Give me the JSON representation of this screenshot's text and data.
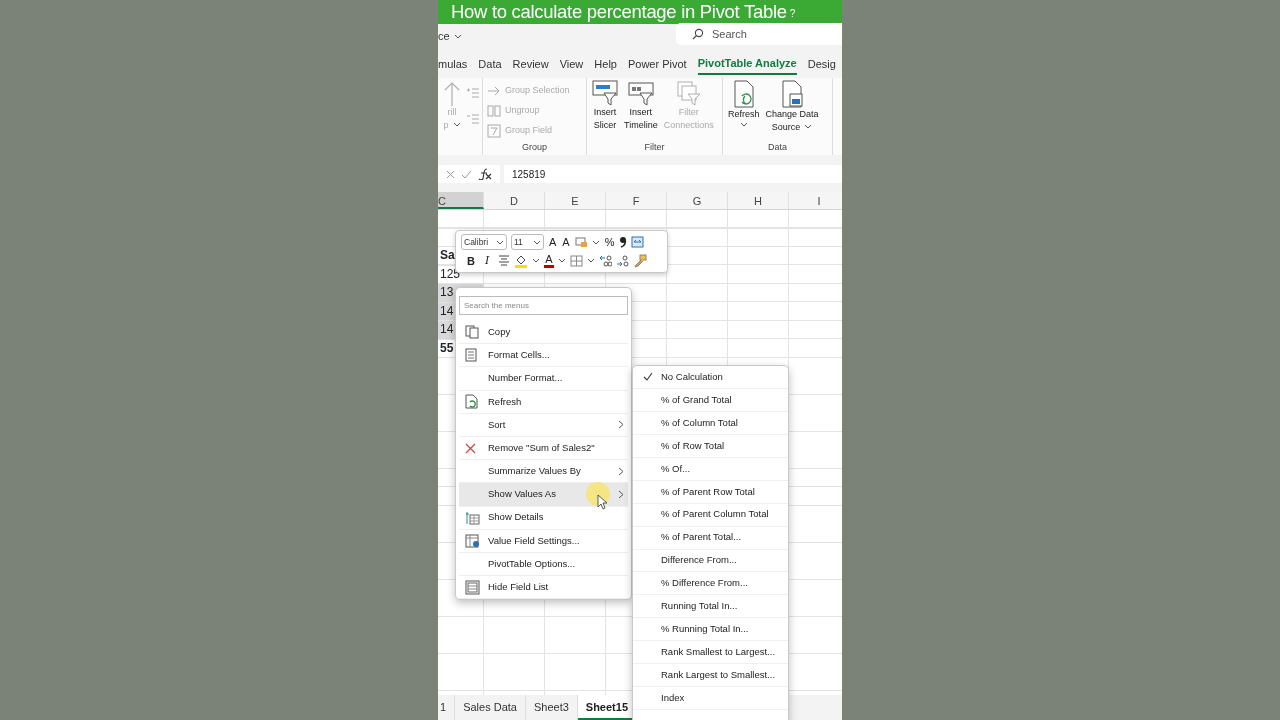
{
  "banner": {
    "title": "How to calculate percentage in Pivot Table",
    "suffix": "?"
  },
  "title_bar": {
    "account": "ce",
    "search": {
      "placeholder": "Search"
    }
  },
  "ribbon_tabs": [
    {
      "label": "mulas",
      "selected": false
    },
    {
      "label": "Data",
      "selected": false
    },
    {
      "label": "Review",
      "selected": false
    },
    {
      "label": "View",
      "selected": false
    },
    {
      "label": "Help",
      "selected": false
    },
    {
      "label": "Power Pivot",
      "selected": false
    },
    {
      "label": "PivotTable Analyze",
      "selected": true
    },
    {
      "label": "Desig",
      "selected": false
    }
  ],
  "ribbon_groups": [
    {
      "items": [
        {
          "kind": "large",
          "lines": [
            "rill",
            "p"
          ],
          "dropdown": true,
          "disabled": true
        },
        {
          "kind": "icons",
          "disabled": true
        }
      ]
    },
    {
      "name": "Group",
      "items": [
        {
          "kind": "small",
          "label": "Group Selection",
          "disabled": true
        },
        {
          "kind": "small",
          "label": "Ungroup",
          "disabled": true
        },
        {
          "kind": "small",
          "label": "Group Field",
          "disabled": true
        }
      ]
    },
    {
      "name": "Filter",
      "items": [
        {
          "kind": "large",
          "lines": [
            "Insert",
            "Slicer"
          ],
          "dropdown": false,
          "disabled": false
        },
        {
          "kind": "large",
          "lines": [
            "Insert",
            "Timeline"
          ],
          "dropdown": false,
          "disabled": false
        },
        {
          "kind": "large",
          "lines": [
            "Filter",
            "Connections"
          ],
          "dropdown": false,
          "disabled": true
        }
      ]
    },
    {
      "name": "Data",
      "items": [
        {
          "kind": "large",
          "lines": [
            "Refresh"
          ],
          "dropdown": true,
          "disabled": false
        },
        {
          "kind": "large",
          "lines": [
            "Change Data",
            "Source"
          ],
          "dropdown": true,
          "disabled": false
        }
      ]
    }
  ],
  "formula_bar": {
    "value": "125819"
  },
  "columns": [
    "C",
    "D",
    "E",
    "F",
    "G",
    "H",
    "I"
  ],
  "cells": [
    {
      "text": "Sa",
      "kind": "header",
      "selected": false
    },
    {
      "text": "125",
      "kind": "value",
      "selected": false
    },
    {
      "text": "13",
      "kind": "value",
      "selected": true
    },
    {
      "text": "14",
      "kind": "value",
      "selected": true
    },
    {
      "text": "14",
      "kind": "value",
      "selected": true
    },
    {
      "text": "55",
      "kind": "total",
      "selected": false
    }
  ],
  "mini_toolbar": {
    "font": "Calibri",
    "size": "11",
    "grow_label": "A",
    "shrink_label": "A",
    "percent_label": "%",
    "bold_label": "B",
    "italic_label": "I",
    "font_color_label": "A"
  },
  "context_menu": {
    "search": {
      "placeholder": "Search the menus"
    },
    "items": [
      {
        "label": "Copy",
        "submenu": false,
        "selected": false
      },
      {
        "label": "Format Cells...",
        "submenu": false,
        "selected": false
      },
      {
        "label": "Number Format...",
        "submenu": false,
        "selected": false
      },
      {
        "label": "Refresh",
        "submenu": false,
        "selected": false
      },
      {
        "label": "Sort",
        "submenu": true,
        "selected": false
      },
      {
        "label": "Remove \"Sum of Sales2\"",
        "submenu": false,
        "selected": false
      },
      {
        "label": "Summarize Values By",
        "submenu": true,
        "selected": false
      },
      {
        "label": "Show Values As",
        "submenu": true,
        "selected": true
      },
      {
        "label": "Show Details",
        "submenu": false,
        "selected": false
      },
      {
        "label": "Value Field Settings...",
        "submenu": false,
        "selected": false
      },
      {
        "label": "PivotTable Options...",
        "submenu": false,
        "selected": false
      },
      {
        "label": "Hide Field List",
        "submenu": false,
        "selected": false
      }
    ]
  },
  "submenu": {
    "items": [
      {
        "label": "No Calculation",
        "checked": true
      },
      {
        "label": "% of Grand Total",
        "checked": false
      },
      {
        "label": "% of Column Total",
        "checked": false
      },
      {
        "label": "% of Row Total",
        "checked": false
      },
      {
        "label": "% Of...",
        "checked": false
      },
      {
        "label": "% of Parent Row Total",
        "checked": false
      },
      {
        "label": "% of Parent Column Total",
        "checked": false
      },
      {
        "label": "% of Parent Total...",
        "checked": false
      },
      {
        "label": "Difference From...",
        "checked": false
      },
      {
        "label": "% Difference From...",
        "checked": false
      },
      {
        "label": "Running Total In...",
        "checked": false
      },
      {
        "label": "% Running Total In...",
        "checked": false
      },
      {
        "label": "Rank Smallest to Largest...",
        "checked": false
      },
      {
        "label": "Rank Largest to Smallest...",
        "checked": false
      },
      {
        "label": "Index",
        "checked": false
      }
    ]
  },
  "sheet_tabs": [
    {
      "label": "1",
      "selected": false
    },
    {
      "label": "Sales Data",
      "selected": false
    },
    {
      "label": "Sheet3",
      "selected": false
    },
    {
      "label": "Sheet15",
      "selected": true
    }
  ]
}
